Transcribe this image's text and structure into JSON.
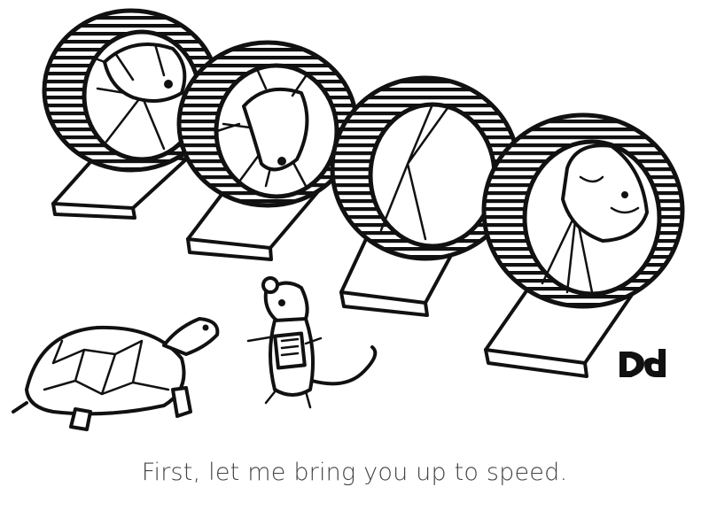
{
  "caption": "First, let me bring you up to speed.",
  "signature": "Dd",
  "colors": {
    "ink": "#111111",
    "caption_text": "#444444",
    "background": "#ffffff"
  }
}
